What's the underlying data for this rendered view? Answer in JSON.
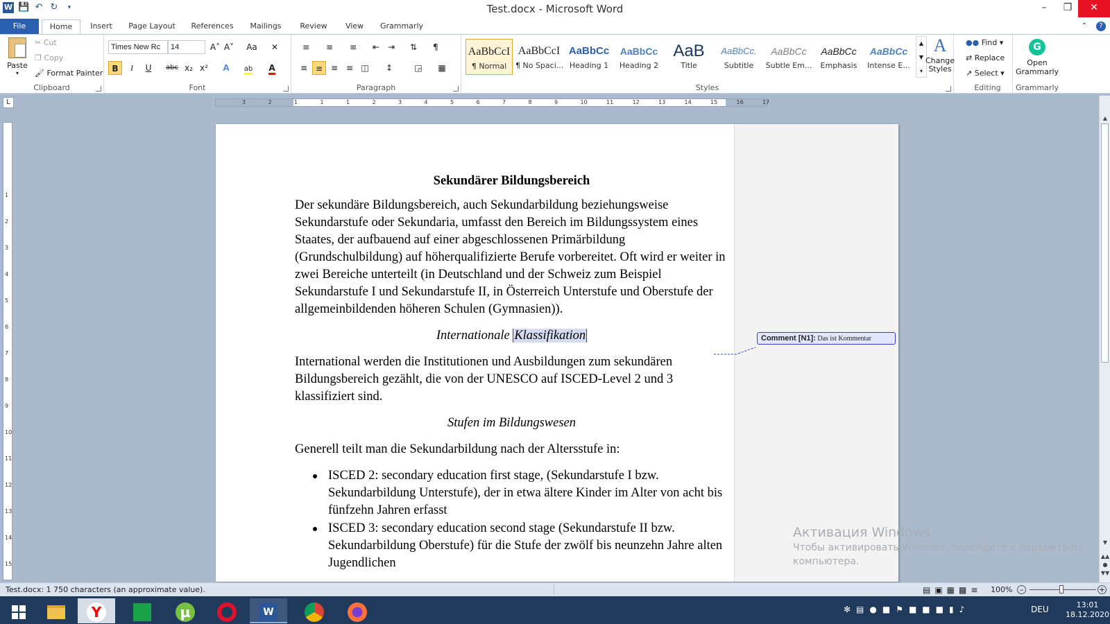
{
  "window": {
    "title": "Test.docx - Microsoft Word",
    "minimize": "–",
    "restore": "❒",
    "close": "✕"
  },
  "tabs": [
    "File",
    "Home",
    "Insert",
    "Page Layout",
    "References",
    "Mailings",
    "Review",
    "View",
    "Grammarly"
  ],
  "clipboard": {
    "label": "Clipboard",
    "paste": "Paste",
    "cut": "Cut",
    "copy": "Copy",
    "format_painter": "Format Painter"
  },
  "font": {
    "label": "Font",
    "family": "Times New Rc",
    "size": "14",
    "grow": "A˄",
    "shrink": "A˅",
    "case": "Aa",
    "bold": "B",
    "italic": "I",
    "underline": "U",
    "strike": "abc",
    "sub": "x₂",
    "sup": "x²",
    "highlight_color": "#ffff00",
    "font_color": "#ff0000"
  },
  "paragraph": {
    "label": "Paragraph",
    "pilcrow": "¶"
  },
  "styles": {
    "label": "Styles",
    "items": [
      {
        "preview": "AaBbCcI",
        "name": "¶ Normal",
        "selected": true
      },
      {
        "preview": "AaBbCcI",
        "name": "¶ No Spaci..."
      },
      {
        "preview": "AaBbCc",
        "name": "Heading 1"
      },
      {
        "preview": "AaBbCc",
        "name": "Heading 2"
      },
      {
        "preview": "AaB",
        "name": "Title"
      },
      {
        "preview": "AaBbCc.",
        "name": "Subtitle"
      },
      {
        "preview": "AaBbCc",
        "name": "Subtle Em..."
      },
      {
        "preview": "AaBbCc",
        "name": "Emphasis"
      },
      {
        "preview": "AaBbCc",
        "name": "Intense E..."
      }
    ],
    "change_styles": "Change Styles"
  },
  "editing": {
    "label": "Editing",
    "find": "Find",
    "replace": "Replace",
    "select": "Select"
  },
  "grammarly": {
    "label": "Grammarly",
    "open": "Open Grammarly"
  },
  "ruler": {
    "numbers": [
      "3",
      "2",
      "1",
      "1",
      "1",
      "2",
      "3",
      "4",
      "5",
      "6",
      "7",
      "8",
      "9",
      "10",
      "11",
      "12",
      "13",
      "14",
      "15",
      "16",
      "17"
    ]
  },
  "vruler": {
    "numbers": [
      "1",
      "2",
      "3",
      "4",
      "5",
      "6",
      "7",
      "8",
      "9",
      "10",
      "11",
      "12",
      "13",
      "14",
      "15"
    ]
  },
  "document": {
    "heading": "Sekundärer Bildungsbereich",
    "para1": "Der sekundäre Bildungsbereich, auch Sekundarbildung beziehungsweise Sekundarstufe oder Sekundaria, umfasst den Bereich im Bildungssystem eines Staates, der aufbauend auf einer abgeschlossenen Primärbildung (Grundschulbildung) auf höherqualifizierte Berufe vorbereitet. Oft wird er weiter in zwei Bereiche unterteilt (in Deutschland und der Schweiz zum Beispiel Sekundarstufe I und Sekundarstufe II, in Österreich Unterstufe und Oberstufe der allgemeinbildenden höheren Schulen (Gymnasien)).",
    "subheading1_plain": "Internationale ",
    "subheading1_commented": "Klassifikation",
    "para2": "International werden die Institutionen und Ausbildungen zum sekundären Bildungsbereich gezählt, die von der UNESCO auf ISCED-Level 2 und 3 klassifiziert sind.",
    "subheading2": "Stufen im Bildungswesen",
    "para3": "Generell teilt man die Sekundarbildung nach der Altersstufe in:",
    "bullets": [
      "ISCED 2: secondary education first stage, (Sekundarstufe I bzw. Sekundarbildung Unterstufe), der in etwa ältere Kinder im Alter von acht bis fünfzehn Jahren erfasst",
      "ISCED 3: secondary education second stage (Sekundarstufe II bzw. Sekundarbildung Oberstufe) für die Stufe der zwölf bis neunzehn Jahre alten Jugendlichen"
    ]
  },
  "comment": {
    "label": "Comment [N1]:",
    "text": "Das ist Kommentar"
  },
  "watermark": {
    "line1": "Активация Windows",
    "line2": "Чтобы активировать Windows, перейдите к параметрам",
    "line3": "компьютера."
  },
  "status": {
    "text": "Test.docx: 1 750 characters (an approximate value).",
    "zoom": "100%"
  },
  "tray": {
    "lang": "DEU",
    "time": "13:01",
    "date": "18.12.2020"
  }
}
